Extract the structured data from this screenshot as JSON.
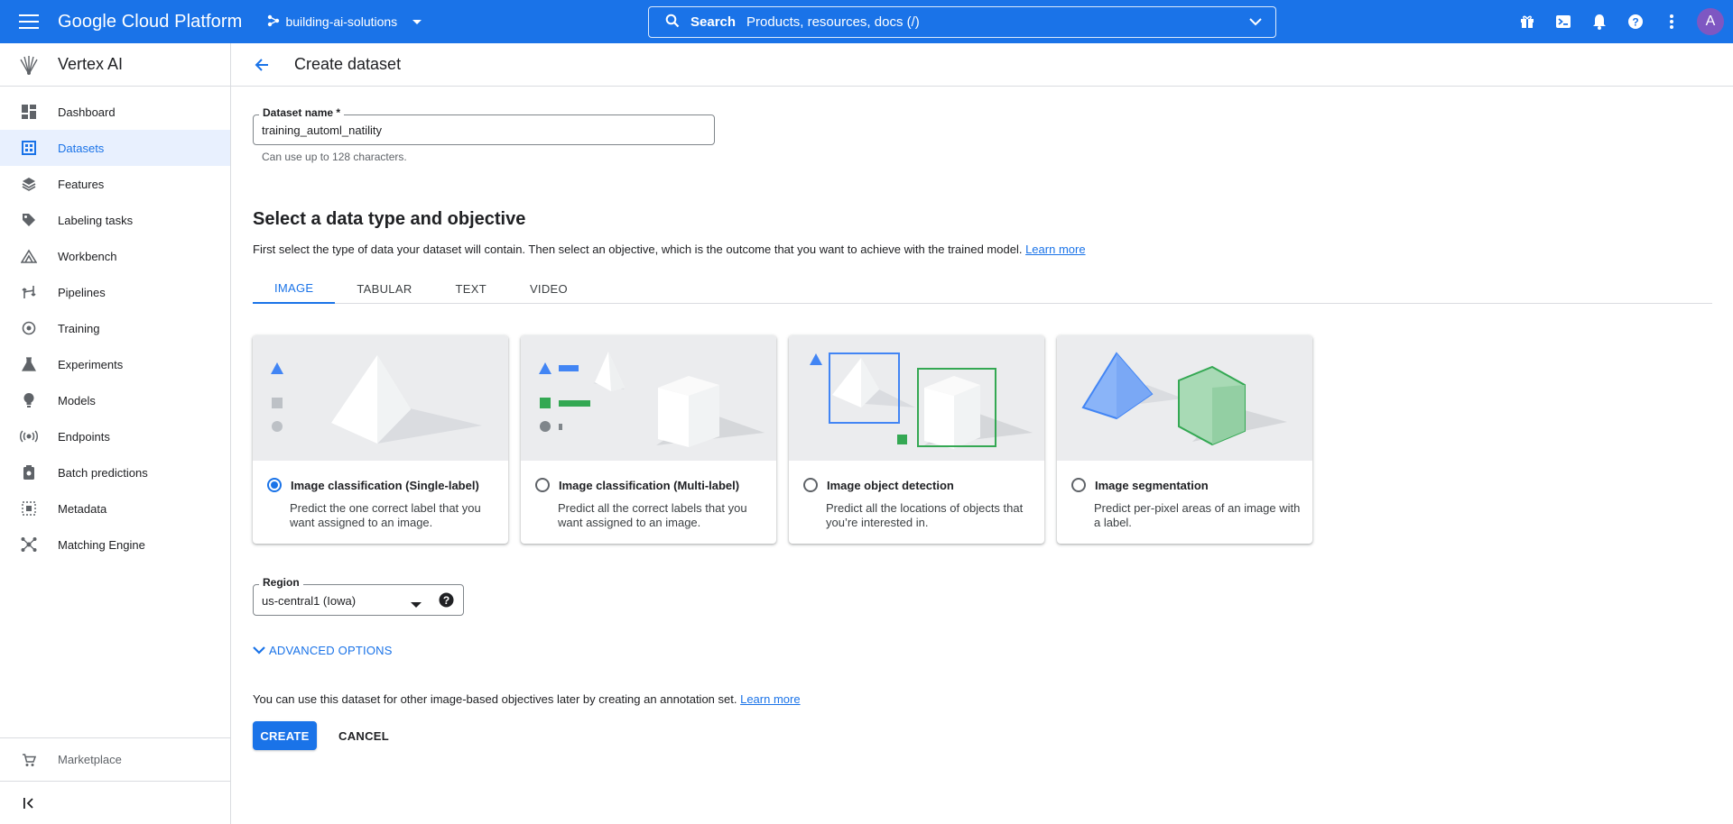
{
  "topbar": {
    "brand": "Google Cloud Platform",
    "project": "building-ai-solutions",
    "search_label": "Search",
    "search_placeholder": "Products, resources, docs (/)",
    "avatar_letter": "A",
    "bar_color": "#1a73e8"
  },
  "sidebar": {
    "product_name": "Vertex AI",
    "items": [
      {
        "label": "Dashboard",
        "icon": "dashboard-icon"
      },
      {
        "label": "Datasets",
        "icon": "datasets-icon",
        "active": true
      },
      {
        "label": "Features",
        "icon": "features-icon"
      },
      {
        "label": "Labeling tasks",
        "icon": "label-tag-icon"
      },
      {
        "label": "Workbench",
        "icon": "workbench-icon"
      },
      {
        "label": "Pipelines",
        "icon": "pipelines-icon"
      },
      {
        "label": "Training",
        "icon": "training-icon"
      },
      {
        "label": "Experiments",
        "icon": "flask-icon"
      },
      {
        "label": "Models",
        "icon": "lightbulb-icon"
      },
      {
        "label": "Endpoints",
        "icon": "endpoints-icon"
      },
      {
        "label": "Batch predictions",
        "icon": "batch-icon"
      },
      {
        "label": "Metadata",
        "icon": "metadata-icon"
      },
      {
        "label": "Matching Engine",
        "icon": "matching-engine-icon"
      }
    ],
    "marketplace": "Marketplace"
  },
  "page": {
    "title": "Create dataset"
  },
  "form": {
    "dataset_name_label": "Dataset name *",
    "dataset_name_value": "training_automl_natility",
    "dataset_name_hint": "Can use up to 128 characters.",
    "section_title": "Select a data type and objective",
    "section_desc": "First select the type of data your dataset will contain. Then select an objective, which is the outcome that you want to achieve with the trained model.",
    "learn_more": "Learn more",
    "tabs": [
      {
        "label": "IMAGE",
        "active": true
      },
      {
        "label": "TABULAR"
      },
      {
        "label": "TEXT"
      },
      {
        "label": "VIDEO"
      }
    ],
    "objectives": [
      {
        "title": "Image classification (Single-label)",
        "desc": "Predict the one correct label that you want assigned to an image.",
        "selected": true
      },
      {
        "title": "Image classification (Multi-label)",
        "desc": "Predict all the correct labels that you want assigned to an image.",
        "selected": false
      },
      {
        "title": "Image object detection",
        "desc": "Predict all the locations of objects that you’re interested in.",
        "selected": false
      },
      {
        "title": "Image segmentation",
        "desc": "Predict per-pixel areas of an image with a label.",
        "selected": false
      }
    ],
    "region_label": "Region",
    "region_value": "us-central1 (Iowa)",
    "advanced_options": "ADVANCED OPTIONS",
    "note": "You can use this dataset for other image-based objectives later by creating an annotation set.",
    "note_link": "Learn more",
    "create_label": "CREATE",
    "cancel_label": "CANCEL"
  }
}
